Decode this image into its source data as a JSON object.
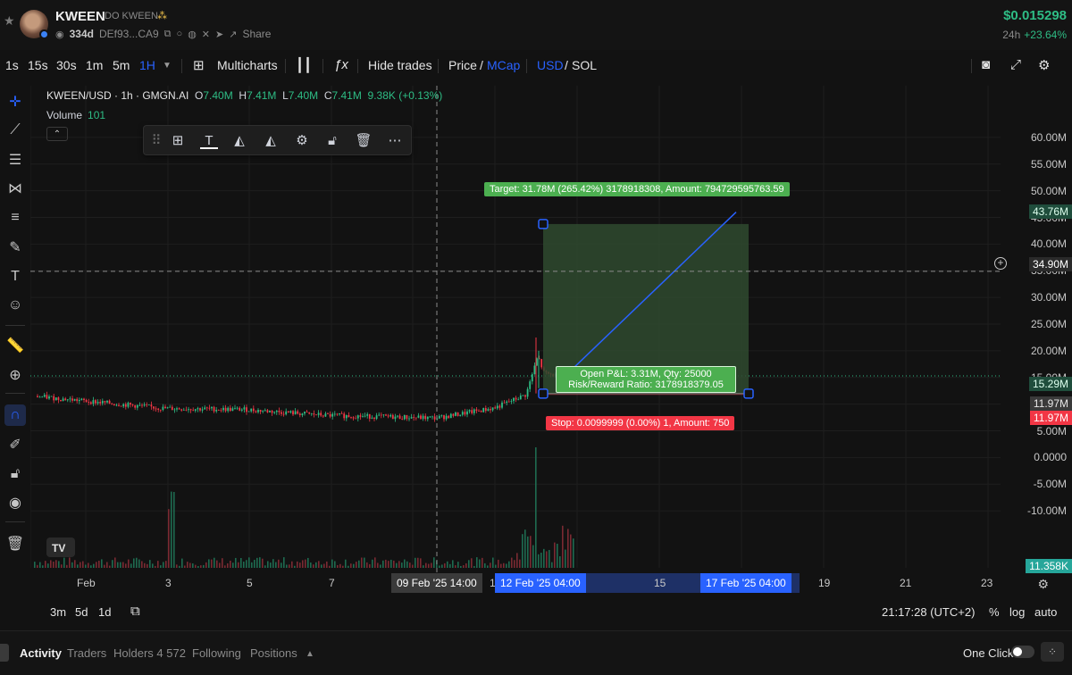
{
  "header": {
    "token_name": "KWEEN",
    "token_subname": "DO KWEEN",
    "age": "334d",
    "address": "DEf93...CA9",
    "share_label": "Share",
    "price": "$0.015298",
    "change_label": "24h",
    "change_value": "+23.64%"
  },
  "toolbar": {
    "intervals": [
      "1s",
      "15s",
      "30s",
      "1m",
      "5m",
      "1H"
    ],
    "active_interval": "1H",
    "multicharts_label": "Multicharts",
    "hide_trades_label": "Hide trades",
    "price_label": "Price",
    "mcap_label": "MCap",
    "usd_label": "USD",
    "sol_label": "SOL",
    "slash": "/"
  },
  "legend": {
    "symbol": "KWEEN/USD · 1h · GMGN.AI",
    "o_key": "O",
    "o_val": "7.40M",
    "h_key": "H",
    "h_val": "7.41M",
    "l_key": "L",
    "l_val": "7.40M",
    "c_key": "C",
    "c_val": "7.41M",
    "extra": "9.38K (+0.13%)",
    "volume_label": "Volume",
    "volume_value": "101"
  },
  "price_axis": [
    "60.00M",
    "55.00M",
    "50.00M",
    "45.00M",
    "40.00M",
    "35.00M",
    "30.00M",
    "25.00M",
    "20.00M",
    "15.00M",
    "10.00M",
    "5.00M",
    "0.0000",
    "-5.00M",
    "-10.00M"
  ],
  "axis_tags": {
    "target": "43.76M",
    "crosshair": "34.90M",
    "current": "15.29M",
    "entry": "11.97M",
    "last": "11.97M",
    "volume": "11.358K"
  },
  "position_tool": {
    "target_label": "Target: 31.78M (265.42%) 3178918308, Amount: 794729595763.59",
    "stop_label": "Stop: 0.0099999 (0.00%) 1, Amount: 750",
    "pnl_line1": "Open P&L: 3.31M, Qty: 25000",
    "pnl_line2": "Risk/Reward Ratio: 3178918379.05"
  },
  "time_axis": {
    "labels": [
      "Feb",
      "3",
      "5",
      "7",
      "15",
      "19",
      "21",
      "23"
    ],
    "crosshair_tag": "09 Feb '25   14:00",
    "start_tag": "12 Feb '25   04:00",
    "end_tag": "17 Feb '25   04:00",
    "partial_label": "1"
  },
  "range_bar": {
    "ranges": [
      "3m",
      "5d",
      "1d"
    ],
    "clock": "21:17:28 (UTC+2)",
    "percent": "%",
    "log": "log",
    "auto": "auto"
  },
  "activity": {
    "tabs": [
      "Activity",
      "Traders",
      "Holders 4 572",
      "Following",
      "Positions"
    ],
    "one_click_label": "One Click"
  },
  "chart_data": {
    "type": "candlestick",
    "title": "KWEEN/USD · 1h · GMGN.AI",
    "ylabel": "",
    "ylim": [
      -15000000,
      65000000
    ],
    "x_ticks": [
      "Feb",
      "3",
      "5",
      "7",
      "15",
      "19",
      "21",
      "23"
    ],
    "last_close": "7.41M",
    "colors": {
      "up": "#2ebd85",
      "down": "#f23645",
      "profit_zone": "#2f4a2f",
      "line": "#2962ff"
    },
    "trend_points": [
      {
        "date": "Feb 1",
        "value": 11.5
      },
      {
        "date": "Feb 3",
        "value": 9.2
      },
      {
        "date": "Feb 5",
        "value": 8.9
      },
      {
        "date": "Feb 7",
        "value": 7.8
      },
      {
        "date": "Feb 9",
        "value": 7.4
      },
      {
        "date": "Feb 11",
        "value": 9.5
      },
      {
        "date": "Feb 12",
        "value": 12.0
      },
      {
        "date": "Feb 12 spike",
        "value": 22.5
      },
      {
        "date": "Feb 13",
        "value": 15.3
      }
    ]
  }
}
